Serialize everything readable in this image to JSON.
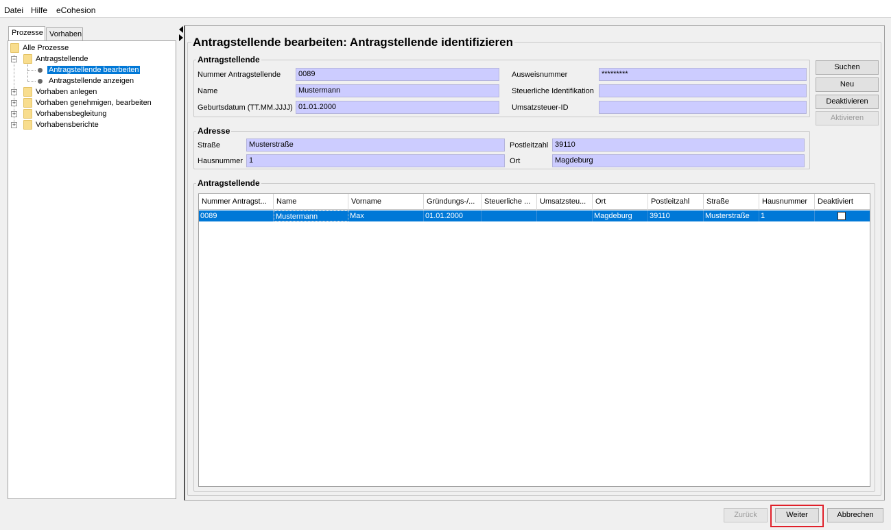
{
  "menu": [
    "Datei",
    "Hilfe",
    "eCohesion"
  ],
  "left_tabs": [
    "Prozesse",
    "Vorhaben"
  ],
  "tree": {
    "root": "Alle Prozesse",
    "antragstellende": "Antragstellende",
    "bearbeiten": "Antragstellende bearbeiten",
    "anzeigen": "Antragstellende anzeigen",
    "vorhaben_anlegen": "Vorhaben anlegen",
    "vorhaben_genehmigen": "Vorhaben genehmigen, bearbeiten",
    "vorhabensbegleitung": "Vorhabensbegleitung",
    "vorhabensberichte": "Vorhabensberichte"
  },
  "title": "Antragstellende bearbeiten: Antragstellende identifizieren",
  "antragsteller_group": {
    "title": "Antragstellende",
    "nummer_label": "Nummer Antragstellende",
    "nummer": "0089",
    "name_label": "Name",
    "name": "Mustermann",
    "geburt_label": "Geburtsdatum (TT.MM.JJJJ)",
    "geburt": "01.01.2000",
    "ausweis_label": "Ausweisnummer",
    "ausweis": "*********",
    "steuer_label": "Steuerliche Identifikation",
    "steuer": "",
    "ust_label": "Umsatzsteuer-ID",
    "ust": ""
  },
  "adresse_group": {
    "title": "Adresse",
    "strasse_label": "Straße",
    "strasse": "Musterstraße",
    "hausnr_label": "Hausnummer",
    "hausnr": "1",
    "plz_label": "Postleitzahl",
    "plz": "39110",
    "ort_label": "Ort",
    "ort": "Magdeburg"
  },
  "side_buttons": {
    "suchen": "Suchen",
    "neu": "Neu",
    "deaktivieren": "Deaktivieren",
    "aktivieren": "Aktivieren"
  },
  "table_group_title": "Antragstellende",
  "table": {
    "headers": [
      "Nummer Antragst...",
      "Name",
      "Vorname",
      "Gründungs-/...",
      "Steuerliche ...",
      "Umsatzsteu...",
      "Ort",
      "Postleitzahl",
      "Straße",
      "Hausnummer",
      "Deaktiviert"
    ],
    "rows": [
      [
        "0089",
        "Mustermann",
        "Max",
        "01.01.2000",
        "",
        "",
        "Magdeburg",
        "39110",
        "Musterstraße",
        "1",
        ""
      ]
    ],
    "row_deaktiviert": [
      false
    ]
  },
  "footer_buttons": {
    "zurueck": "Zurück",
    "weiter": "Weiter",
    "abbrechen": "Abbrechen"
  }
}
